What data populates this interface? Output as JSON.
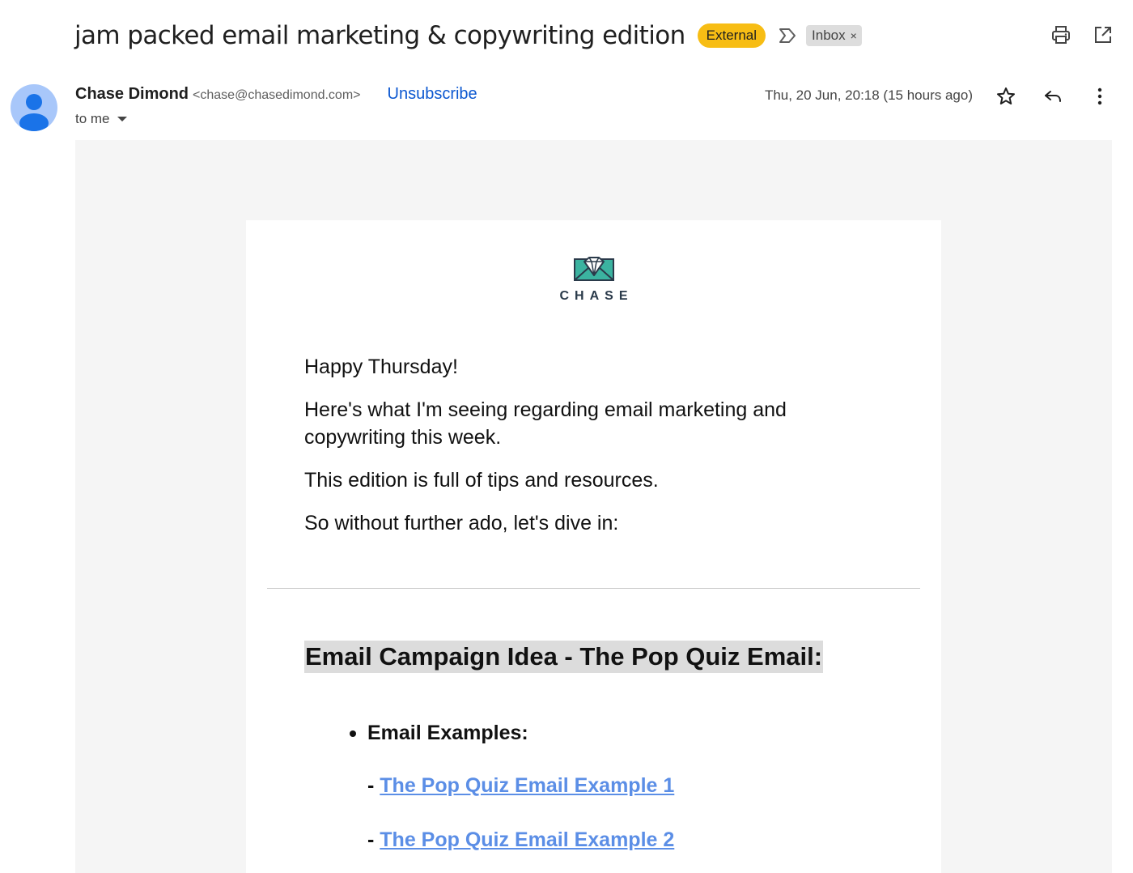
{
  "subject": {
    "title": "jam packed email marketing & copywriting edition",
    "external_badge": "External",
    "inbox_chip": "Inbox",
    "chip_remove": "×"
  },
  "sender": {
    "name": "Chase Dimond",
    "email": "<chase@chasedimond.com>",
    "unsubscribe": "Unsubscribe",
    "recipient": "to me",
    "date": "Thu, 20 Jun, 20:18 (15 hours ago)"
  },
  "email": {
    "logo_text": "CHASE",
    "paragraphs": [
      "Happy Thursday!",
      "Here's what I'm seeing regarding email marketing and copywriting this week.",
      "This edition is full of tips and resources.",
      "So without further ado, let's dive in:"
    ],
    "section_title": "Email Campaign Idea - The Pop Quiz Email:",
    "bullet": "Email Examples:",
    "links": [
      {
        "prefix": "- ",
        "label": "The Pop Quiz Email Example 1"
      },
      {
        "prefix": "- ",
        "label": "The Pop Quiz Email Example 2"
      }
    ]
  },
  "colors": {
    "external_badge": "#f7bd14",
    "unsubscribe": "#0b57d0",
    "link": "#5b8ee6",
    "avatar_bg": "#a8c7fa",
    "avatar_fg": "#1a73e8",
    "logo_teal": "#3bb3a0",
    "logo_navy": "#2a3a4a"
  },
  "icons": {
    "label": "label-outline-icon",
    "print": "print-icon",
    "popout": "open-in-new-window-icon",
    "star": "star-outline-icon",
    "reply": "reply-icon",
    "more": "more-vertical-icon",
    "avatar": "person-avatar-icon",
    "logo": "diamond-envelope-logo"
  }
}
